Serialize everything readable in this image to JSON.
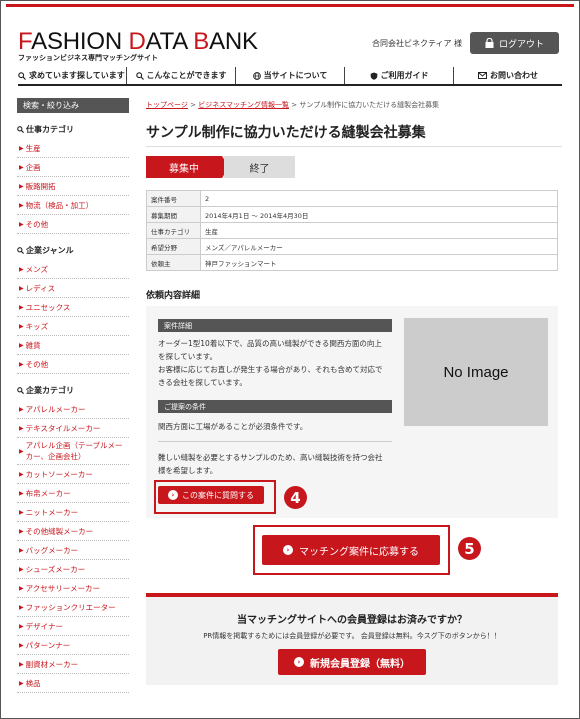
{
  "header": {
    "logo_part1": "F",
    "logo_part2": "ASHION ",
    "logo_part3": "D",
    "logo_part4": "ATA ",
    "logo_part5": "B",
    "logo_part6": "ANK",
    "logo_sub": "ファッションビジネス専門マッチングサイト",
    "company": "合同会社ビネクティア 様",
    "logout": "ログアウト"
  },
  "nav": [
    {
      "label": "求めています探しています",
      "icon": "search-icon"
    },
    {
      "label": "こんなことができます",
      "icon": "search-icon"
    },
    {
      "label": "当サイトについて",
      "icon": "globe-icon"
    },
    {
      "label": "ご利用ガイド",
      "icon": "shield-icon"
    },
    {
      "label": "お問い合わせ",
      "icon": "mail-icon"
    }
  ],
  "sidebar": {
    "heading": "検索・絞り込み",
    "job_category_title": "仕事カテゴリ",
    "job_categories": [
      "生産",
      "企画",
      "販路開拓",
      "物流（検品・加工）",
      "その他"
    ],
    "genre_title": "企業ジャンル",
    "genres": [
      "メンズ",
      "レディス",
      "ユニセックス",
      "キッズ",
      "雑貨",
      "その他"
    ],
    "company_category_title": "企業カテゴリ",
    "company_categories": [
      "アパレルメーカー",
      "テキスタイルメーカー",
      "アパレル企画（テーブルメーカー、企画会社）",
      "カットソーメーカー",
      "布帛メーカー",
      "ニットメーカー",
      "その他縫製メーカー",
      "バッグメーカー",
      "シューズメーカー",
      "アクセサリーメーカー",
      "ファッションクリエーター",
      "デザイナー",
      "パターンナー",
      "副資材メーカー",
      "検品"
    ]
  },
  "breadcrumb": {
    "top": "トップページ",
    "sep": " > ",
    "list": "ビジネスマッチング情報一覧",
    "current": "サンプル制作に協力いただける縫製会社募集"
  },
  "page_title": "サンプル制作に協力いただける縫製会社募集",
  "status": {
    "active": "募集中",
    "ended": "終了"
  },
  "info": [
    {
      "key": "案件番号",
      "value": "2"
    },
    {
      "key": "募集期間",
      "value": "2014年4月1日 〜 2014年4月30日"
    },
    {
      "key": "仕事カテゴリ",
      "value": "生産"
    },
    {
      "key": "希望分野",
      "value": "メンズ／アパレルメーカー"
    },
    {
      "key": "依頼主",
      "value": "神戸ファッションマート"
    }
  ],
  "detail_section_title": "依頼内容詳細",
  "detail": {
    "bar1": "案件詳細",
    "text1_l1": "オーダー1型10着以下で、品質の高い縫製ができる関西方面の向上",
    "text1_l2": "を探しています。",
    "text1_l3": "お客様に応じてお直しが発生する場合があり、それも含めて対応で",
    "text1_l4": "きる会社を探しています。",
    "bar2": "ご提案の条件",
    "text2": "関西方面に工場があることが必須条件です。",
    "text3_l1": "難しい縫製を必要とするサンプルのため、高い縫製技術を持つ会社",
    "text3_l2": "様を希望します。",
    "no_image": "No Image",
    "question_button": "この案件に質問する"
  },
  "apply_button": "マッチング案件に応募する",
  "badges": {
    "question": "4",
    "apply": "5"
  },
  "register": {
    "title": "当マッチングサイトへの会員登録はお済みですか？",
    "note": "PR情報を掲載するためには会員登録が必要です。 会員登録は無料。今スグ下のボタンから！！",
    "button": "新規会員登録（無料）"
  },
  "colors": {
    "accent": "#c8161d",
    "dark": "#555555"
  }
}
